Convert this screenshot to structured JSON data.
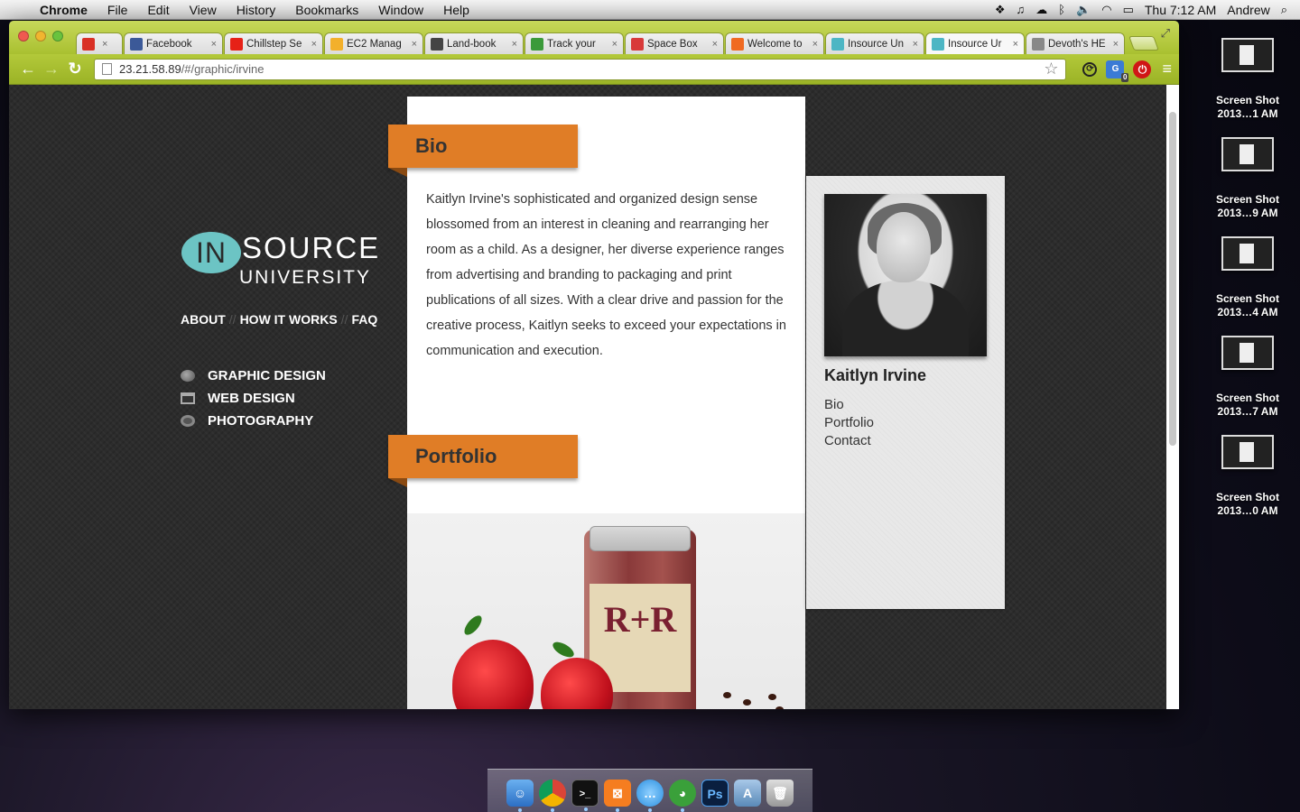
{
  "menubar": {
    "app_name": "Chrome",
    "menus": [
      "File",
      "Edit",
      "View",
      "History",
      "Bookmarks",
      "Window",
      "Help"
    ],
    "clock": "Thu 7:12 AM",
    "user": "Andrew"
  },
  "tabs": [
    {
      "label": "",
      "icon": "gmail-icon",
      "color": "#d93025"
    },
    {
      "label": "Facebook",
      "icon": "facebook-icon",
      "color": "#3b5998"
    },
    {
      "label": "Chillstep Se",
      "icon": "youtube-icon",
      "color": "#e62117"
    },
    {
      "label": "EC2 Manag",
      "icon": "aws-icon",
      "color": "#f3b02b"
    },
    {
      "label": "Land-book",
      "icon": "landbook-icon",
      "color": "#444444"
    },
    {
      "label": "Track your",
      "icon": "leaf-icon",
      "color": "#3b9a3a"
    },
    {
      "label": "Space Box",
      "icon": "spacebox-icon",
      "color": "#d83a3a"
    },
    {
      "label": "Welcome to",
      "icon": "blogger-icon",
      "color": "#f06a21"
    },
    {
      "label": "Insource Un",
      "icon": "insource-icon",
      "color": "#4db6c4"
    },
    {
      "label": "Insource Ur",
      "icon": "insource-icon",
      "color": "#4db6c4"
    },
    {
      "label": "Devoth's HE",
      "icon": "document-icon",
      "color": "#888888"
    }
  ],
  "omnibox": {
    "host": "23.21.58.89",
    "path": "/#/graphic/irvine"
  },
  "site": {
    "logo": {
      "in": "IN",
      "source": "SOURCE",
      "university": "UNIVERSITY"
    },
    "topnav": [
      "ABOUT",
      "HOW IT WORKS",
      "FAQ"
    ],
    "topnav_sep": "//",
    "categories": [
      "GRAPHIC DESIGN",
      "WEB DESIGN",
      "PHOTOGRAPHY"
    ],
    "bio_heading": "Bio",
    "bio_text": "Kaitlyn Irvine's sophisticated and organized design sense blossomed from an interest in cleaning and rearranging her room as a child. As a designer, her diverse experience ranges from advertising and branding to packaging and print publications of all sizes. With a clear drive and passion for the creative process, Kaitlyn seeks to exceed your expectations in communication and execution.",
    "portfolio_heading": "Portfolio",
    "portfolio_jar_label": "R+R",
    "profile": {
      "name": "Kaitlyn Irvine",
      "links": [
        "Bio",
        "Portfolio",
        "Contact"
      ]
    },
    "accent_color": "#e07d26",
    "logo_color": "#6cc4c4"
  },
  "desktop": {
    "screenshots": [
      {
        "line1": "Screen Shot",
        "line2": "2013…1 AM"
      },
      {
        "line1": "Screen Shot",
        "line2": "2013…9 AM"
      },
      {
        "line1": "Screen Shot",
        "line2": "2013…4 AM"
      },
      {
        "line1": "Screen Shot",
        "line2": "2013…7 AM"
      },
      {
        "line1": "Screen Shot",
        "line2": "2013…0 AM"
      }
    ]
  },
  "dock": {
    "apps": [
      "finder-icon",
      "chrome-icon",
      "terminal-icon",
      "xampp-icon",
      "messages-icon",
      "adium-icon",
      "photoshop-icon",
      "applications-folder-icon",
      "trash-icon"
    ],
    "photoshop_label": "Ps"
  },
  "extensions": {
    "badge_count": "0"
  }
}
